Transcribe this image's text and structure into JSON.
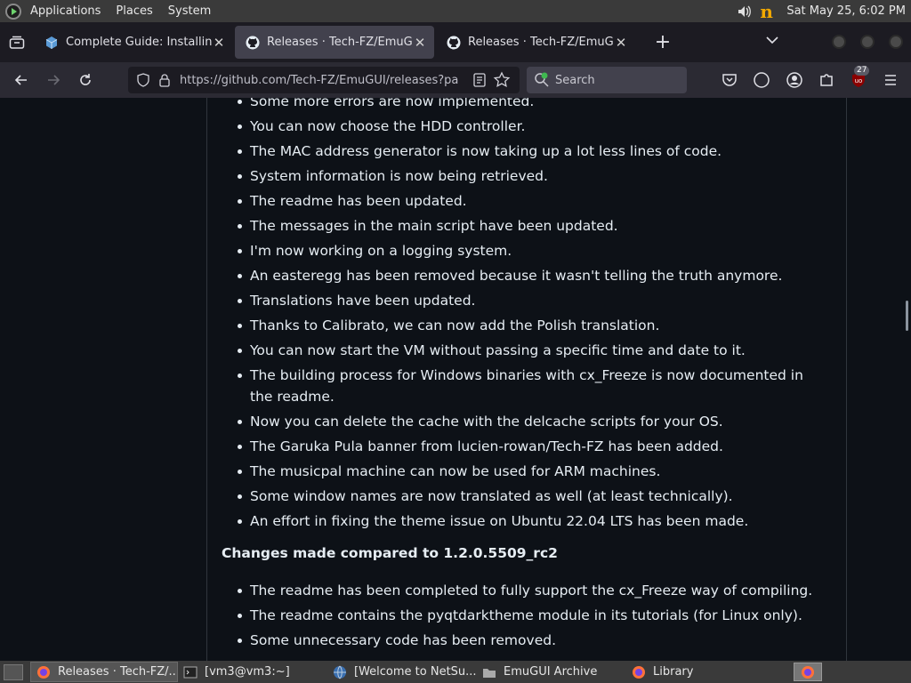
{
  "top_panel": {
    "menus": [
      "Applications",
      "Places",
      "System"
    ],
    "clock": "Sat May 25,  6:02 PM"
  },
  "tabs": [
    {
      "title": "Complete Guide: Installing ",
      "active": false
    },
    {
      "title": "Releases · Tech-FZ/EmuGUI",
      "active": true
    },
    {
      "title": "Releases · Tech-FZ/EmuGUI",
      "active": false
    }
  ],
  "nav": {
    "url": "https://github.com/Tech-FZ/EmuGUI/releases?pa",
    "search_placeholder": "Search",
    "extension_badge": "27"
  },
  "release_notes": {
    "items_top": [
      "Some more errors are now implemented.",
      "You can now choose the HDD controller.",
      "The MAC address generator is now taking up a lot less lines of code.",
      "System information is now being retrieved.",
      "The readme has been updated.",
      "The messages in the main script have been updated.",
      "I'm now working on a logging system.",
      "An easteregg has been removed because it wasn't telling the truth anymore.",
      "Translations have been updated.",
      "Thanks to Calibrato, we can now add the Polish translation.",
      "You can now start the VM without passing a specific time and date to it.",
      "The building process for Windows binaries with cx_Freeze is now documented in the readme.",
      "Now you can delete the cache with the delcache scripts for your OS.",
      "The Garuka Pula banner from lucien-rowan/Tech-FZ has been added.",
      "The musicpal machine can now be used for ARM machines.",
      "Some window names are now translated as well (at least technically).",
      "An effort in fixing the theme issue on Ubuntu 22.04 LTS has been made."
    ],
    "section_heading": "Changes made compared to 1.2.0.5509_rc2",
    "items_bottom": [
      "The readme has been completed to fully support the cx_Freeze way of compiling.",
      "The readme contains the pyqtdarktheme module in its tutorials (for Linux only).",
      "Some unnecessary code has been removed."
    ]
  },
  "taskbar": {
    "tasks": [
      {
        "label": "Releases · Tech-FZ/...",
        "icon": "firefox-icon",
        "active": true
      },
      {
        "label": "[vm3@vm3:~]",
        "icon": "terminal-icon",
        "active": false
      },
      {
        "label": "[Welcome to NetSu...",
        "icon": "globe-icon",
        "active": false
      },
      {
        "label": "EmuGUI Archive",
        "icon": "folder-icon",
        "active": false
      },
      {
        "label": "Library",
        "icon": "firefox-icon",
        "active": false
      }
    ]
  }
}
